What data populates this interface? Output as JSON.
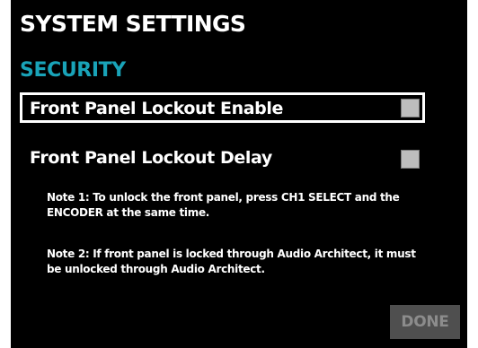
{
  "screen": {
    "title": "SYSTEM SETTINGS",
    "section": "SECURITY"
  },
  "settings": [
    {
      "label": "Front Panel Lockout Enable",
      "checked": false,
      "selected": true
    },
    {
      "label": "Front Panel Lockout Delay",
      "checked": false,
      "selected": false
    }
  ],
  "notes": [
    "Note 1: To unlock the front panel, press CH1 SELECT and the ENCODER at the same time.",
    "Note 2: If front panel is locked through Audio Architect, it must be unlocked through Audio Architect."
  ],
  "buttons": {
    "done_label": "DONE",
    "done_enabled": false
  },
  "colors": {
    "background": "#000000",
    "text": "#ffffff",
    "section_accent": "#19a3b8",
    "checkbox_fill": "#bdbdbd",
    "done_bg": "#4f4f4f",
    "done_text": "#8c8c8c"
  }
}
